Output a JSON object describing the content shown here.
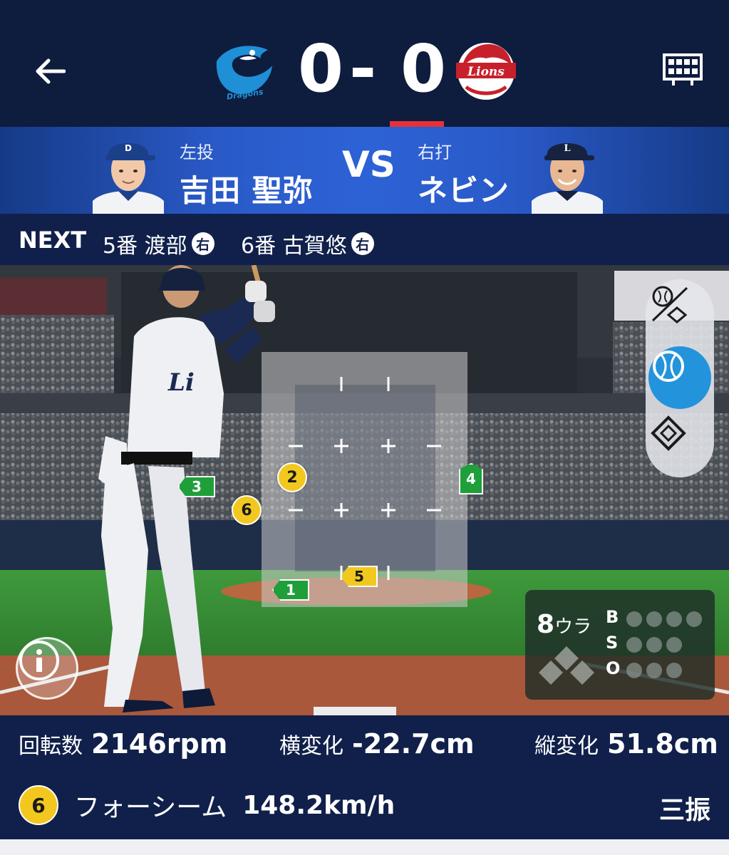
{
  "header": {
    "home_score": "0",
    "dash": "-",
    "away_score": "0",
    "home_team_icon": "dragons-logo",
    "home_team_wordmark": "Dragons",
    "away_team_icon": "lions-logo",
    "away_team_wordmark": "Lions",
    "accent_color": "#e53138"
  },
  "matchup": {
    "pitcher_role": "左投",
    "pitcher_name": "吉田 聖弥",
    "vs": "VS",
    "batter_role": "右打",
    "batter_name": "ネビン"
  },
  "next": {
    "label": "NEXT",
    "batters": [
      {
        "order": "5番 渡部",
        "hand": "右"
      },
      {
        "order": "6番 古賀悠",
        "hand": "右"
      }
    ]
  },
  "pitches": [
    {
      "num": "1",
      "kind": "flag-green"
    },
    {
      "num": "2",
      "kind": "circle"
    },
    {
      "num": "3",
      "kind": "flag-green"
    },
    {
      "num": "4",
      "kind": "flag-green"
    },
    {
      "num": "5",
      "kind": "flag-yellow"
    },
    {
      "num": "6",
      "kind": "circle"
    }
  ],
  "situation": {
    "inning_number": "8",
    "inning_half": "ウラ",
    "b_label": "B",
    "s_label": "S",
    "o_label": "O",
    "balls": 0,
    "strikes": 0,
    "outs": 0
  },
  "stats": {
    "spin_label": "回転数",
    "spin_value": "2146rpm",
    "hbreak_label": "横変化",
    "hbreak_value": "-22.7cm",
    "vbreak_label": "縦変化",
    "vbreak_value": "51.8cm",
    "pitch_number": "6",
    "pitch_type": "フォーシーム",
    "pitch_speed": "148.2km/h",
    "result": "三振"
  },
  "icons": {
    "back": "back-arrow-icon",
    "scoreboard": "scoreboard-icon",
    "pitch_location_view": "ball-and-diamond-icon",
    "ball_view": "baseball-icon",
    "field_view": "diamond-icon",
    "info": "info-icon"
  },
  "colors": {
    "header_bg": "#0e1c3e",
    "matchup_blue": "#2d62d6",
    "active_blue": "#2393dc",
    "marker_yellow": "#f2c81f",
    "marker_green": "#1f9f3a"
  }
}
